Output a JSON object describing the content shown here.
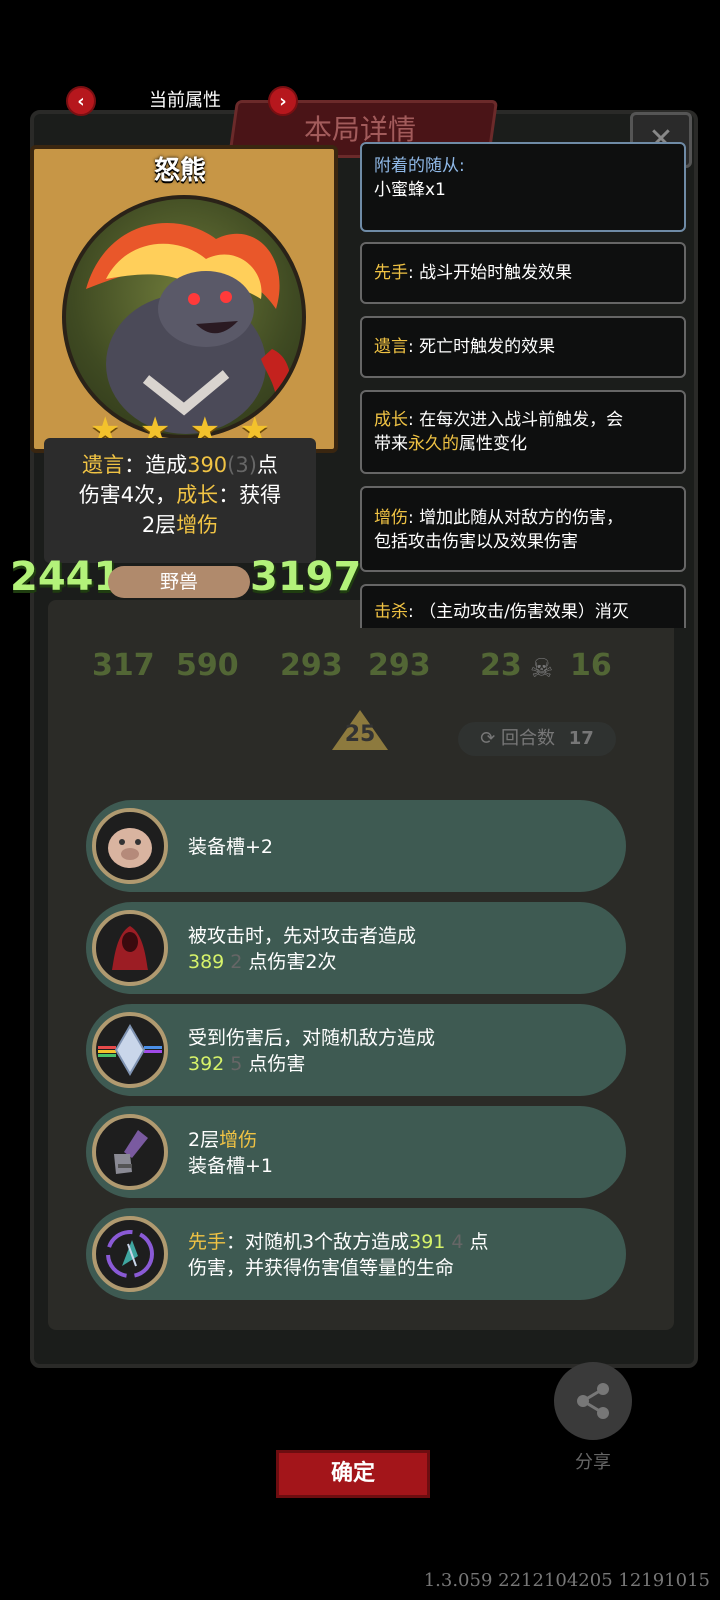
{
  "header": {
    "title": "当前属性",
    "prev": "‹",
    "next": "›"
  },
  "background": {
    "banner_title": "本局详情",
    "close_icon": "✕",
    "round_label": "回合数",
    "round_value": "17",
    "arrow_value": "25",
    "mini_stats": [
      [
        "317",
        "590"
      ],
      [
        "293",
        "293"
      ],
      [
        "23",
        "16"
      ]
    ]
  },
  "card": {
    "name": "怒熊",
    "stars": 4,
    "desc": {
      "l1_kw": "遗言",
      "l1_a": "：造成",
      "l1_num": "390",
      "l1_b": "(3)",
      "l1_c": "点",
      "l2_a": "伤害4次，",
      "l2_kw": "成长",
      "l2_b": "：获得",
      "l3_a": "2层",
      "l3_kw": "增伤"
    },
    "attack": "2441",
    "health": "3197",
    "tribe": "野兽"
  },
  "keywords": [
    {
      "title": "附着的随从:",
      "text": "小蜜蜂x1"
    },
    {
      "title": "先手",
      "text": ": 战斗开始时触发效果"
    },
    {
      "title": "遗言",
      "text": ": 死亡时触发的效果"
    },
    {
      "title": "成长",
      "text": ": 在每次进入战斗前触发，会",
      "text2a": "带来",
      "text2kw": "永久的",
      "text2b": "属性变化"
    },
    {
      "title": "增伤",
      "text": ": 增加此随从对敌方的伤害，",
      "text2": "包括攻击伤害以及效果伤害"
    },
    {
      "title": "击杀",
      "text": ": （主动攻击/伤害效果）消灭"
    }
  ],
  "items": [
    {
      "line1": "装备槽+2"
    },
    {
      "line1": "被攻击时，先对攻击者造成",
      "num": "389",
      "ghost": "2",
      "line2": "点伤害2次"
    },
    {
      "line1": "受到伤害后，对随机敌方造成",
      "num": "392",
      "ghost": "5",
      "line2": "点伤害"
    },
    {
      "line1a": "2层",
      "line1kw": "增伤",
      "line2": "装备槽+1"
    },
    {
      "kw": "先手",
      "line1": "：对随机3个敌方造成",
      "num": "391",
      "ghost": "4",
      "tail": "点",
      "line2": "伤害，并获得伤害值等量的生命"
    }
  ],
  "share": {
    "label": "分享"
  },
  "confirm": {
    "label": "确定"
  },
  "version": "1.3.059 2212104205 12191015",
  "colors": {
    "accent_red": "#b6171d",
    "keyword_yellow": "#f0c344",
    "number_lime": "#d6f26a",
    "stat_green": "#b3f27a",
    "item_bg": "#3e5a52"
  }
}
